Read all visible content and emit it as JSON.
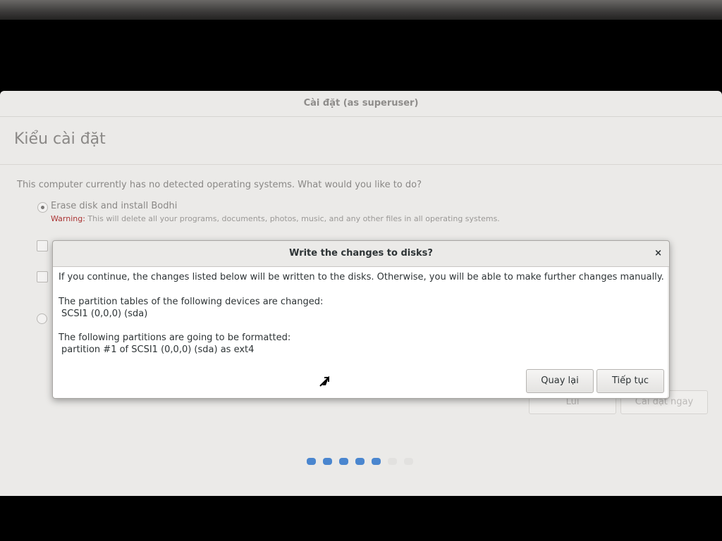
{
  "installer": {
    "window_title": "Cài đặt (as superuser)",
    "page_title": "Kiểu cài đặt",
    "question": "This computer currently has no detected operating systems. What would you like to do?",
    "options": [
      {
        "label": "Erase disk and install Bodhi",
        "selected": true
      }
    ],
    "warning_prefix": "Warning:",
    "warning_text": " This will delete all your programs, documents, photos, music, and any other files in all operating systems.",
    "back_button": "Lùi",
    "install_button": "Cài đặt ngay",
    "progress": {
      "total_steps": 7,
      "completed_steps": 5
    }
  },
  "dialog": {
    "title": "Write the changes to disks?",
    "close_glyph": "×",
    "intro": "If you continue, the changes listed below will be written to the disks. Otherwise, you will be able to make further changes manually.",
    "partition_tables_heading": "The partition tables of the following devices are changed:",
    "partition_tables_items": [
      "SCSI1 (0,0,0) (sda)"
    ],
    "formatted_heading": "The following partitions are going to be formatted:",
    "formatted_items": [
      "partition #1 of SCSI1 (0,0,0) (sda) as ext4"
    ],
    "back_button": "Quay lại",
    "continue_button": "Tiếp tục"
  },
  "colors": {
    "accent": "#4a86cf",
    "warning": "#aa3333"
  }
}
